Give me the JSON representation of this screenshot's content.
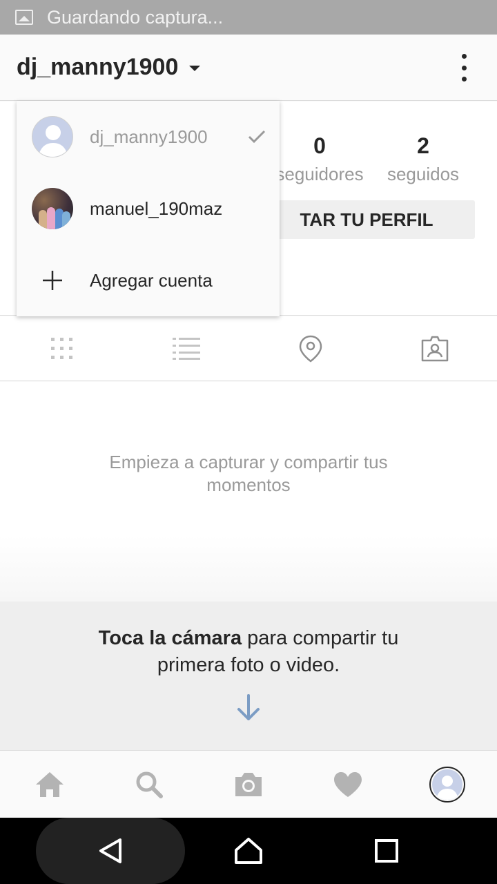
{
  "status_bar": {
    "notification_text": "Guardando captura..."
  },
  "header": {
    "username": "dj_manny1900"
  },
  "stats": {
    "followers": {
      "count": "0",
      "label": "seguidores"
    },
    "following": {
      "count": "2",
      "label": "seguidos"
    }
  },
  "edit_profile_label": "TAR TU PERFIL",
  "account_menu": {
    "accounts": [
      {
        "name": "dj_manny1900",
        "active": true
      },
      {
        "name": "manuel_190maz",
        "active": false
      }
    ],
    "add_account_label": "Agregar cuenta"
  },
  "profile_tabs": [
    "grid-icon",
    "list-icon",
    "location-pin-icon",
    "tagged-photos-icon"
  ],
  "empty_state": {
    "message": "Empieza a capturar y compartir tus momentos"
  },
  "camera_hint": {
    "bold": "Toca la cámara",
    "rest": " para compartir tu primera foto o video."
  },
  "bottom_nav": [
    "home-icon",
    "search-icon",
    "camera-icon",
    "heart-icon",
    "profile-avatar"
  ],
  "colors": {
    "accent_arrow": "#7b9cc4",
    "icon_gray": "#b3b3b3",
    "muted_text": "#9a9a9a"
  }
}
